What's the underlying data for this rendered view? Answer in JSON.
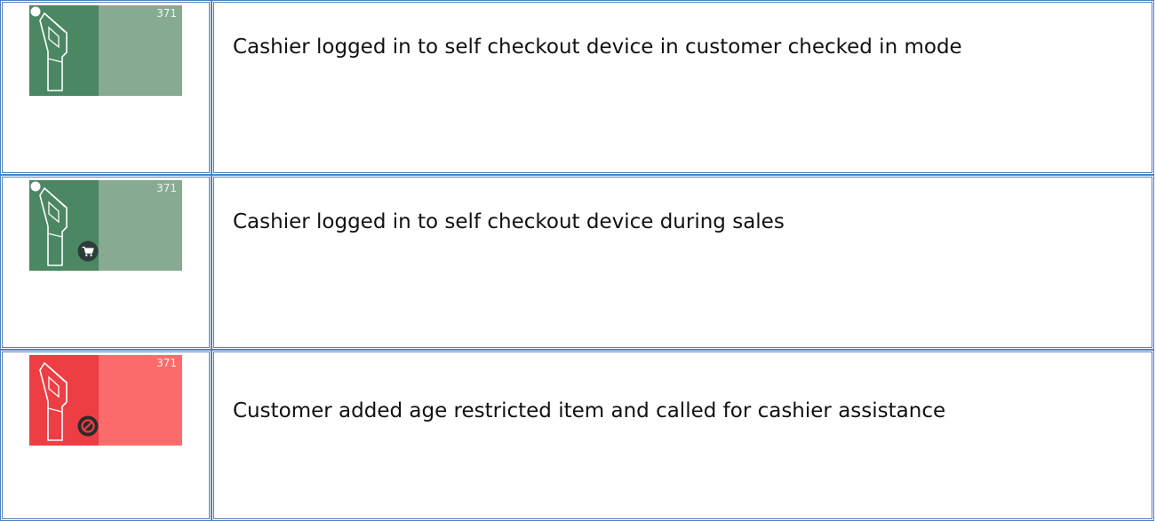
{
  "colors": {
    "border": "#4f81bd",
    "green_dark": "#4a8762",
    "green_light": "#86ab92",
    "red_dark": "#ed3e44",
    "red_light": "#fb6b6c"
  },
  "rows": [
    {
      "tile": {
        "number": "371",
        "state": "green",
        "icon": "self-checkout-kiosk-icon",
        "badge": "none"
      },
      "description": "Cashier logged in to self checkout device in customer checked in mode"
    },
    {
      "tile": {
        "number": "371",
        "state": "green",
        "icon": "self-checkout-kiosk-icon",
        "badge": "shopping-cart-icon"
      },
      "description": "Cashier logged in to self checkout device during sales"
    },
    {
      "tile": {
        "number": "371",
        "state": "red",
        "icon": "self-checkout-kiosk-icon",
        "badge": "prohibited-icon"
      },
      "description": "Customer added age restricted item and called for cashier assistance"
    }
  ]
}
